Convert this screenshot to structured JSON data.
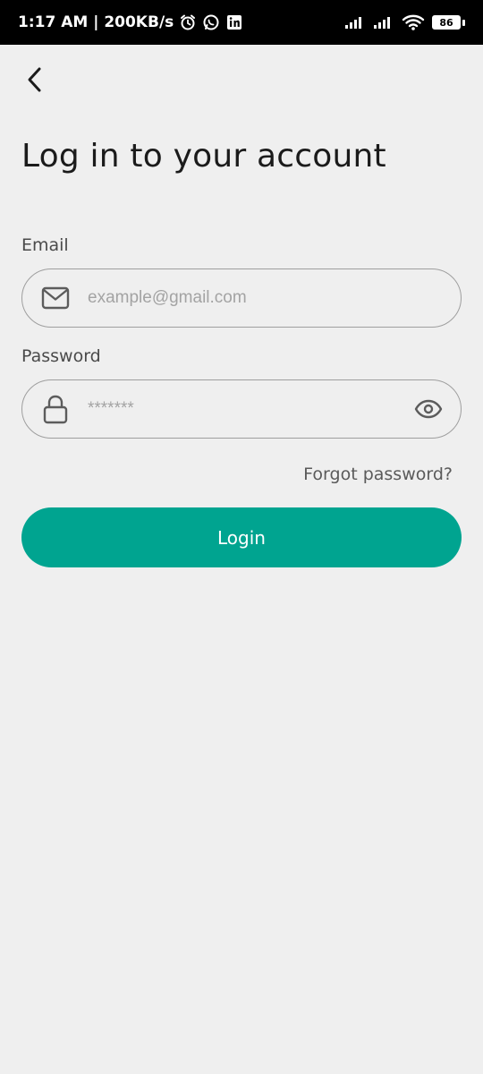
{
  "status_bar": {
    "time_speed": "1:17 AM | 200KB/s",
    "battery": "86",
    "icons": [
      "alarm-icon",
      "whatsapp-icon",
      "linkedin-icon",
      "signal-icon",
      "signal-icon",
      "wifi-icon",
      "battery-icon"
    ]
  },
  "header": {
    "back_icon": "chevron-left-icon",
    "title": "Log in to your account"
  },
  "form": {
    "email": {
      "label": "Email",
      "placeholder": "example@gmail.com",
      "value": "",
      "icon": "mail-icon"
    },
    "password": {
      "label": "Password",
      "placeholder": "*******",
      "value": "",
      "icon": "lock-icon",
      "toggle_icon": "eye-icon"
    },
    "forgot_password": "Forgot password?",
    "login_label": "Login"
  },
  "colors": {
    "accent": "#00a490",
    "background": "#efefef",
    "status_bar": "#000000"
  }
}
